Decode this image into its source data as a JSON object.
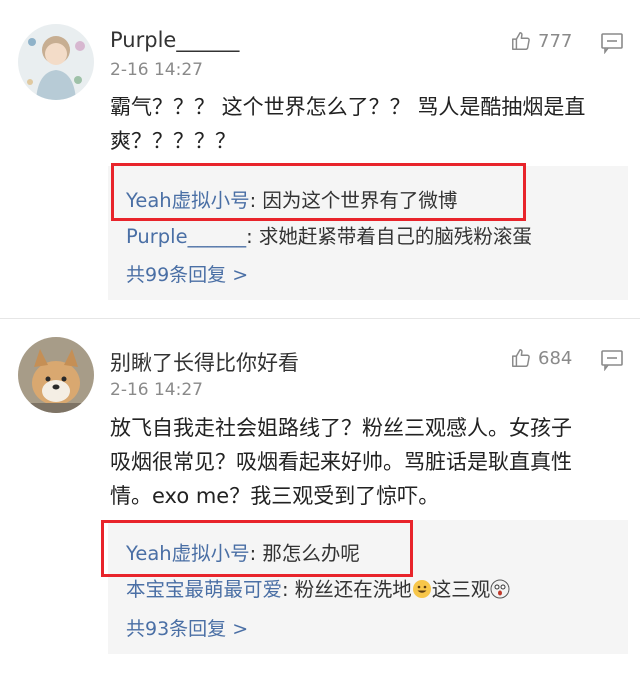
{
  "comments": [
    {
      "username": "Purple______",
      "time": "2-16 14:27",
      "likes": "777",
      "text_line1": "霸气？？？ 这个世界怎么了？？ 骂人是酷抽烟是直",
      "text_line2": "爽？？？？？",
      "replies": [
        {
          "name": "Yeah虚拟小号",
          "text": ": 因为这个世界有了微博"
        },
        {
          "name": "Purple______",
          "text": ": 求她赶紧带着自己的脑残粉滚蛋"
        }
      ],
      "more": "共99条回复 >"
    },
    {
      "username": "别瞅了长得比你好看",
      "time": "2-16 14:27",
      "likes": "684",
      "text_line1": "放飞自我走社会姐路线了？粉丝三观感人。女孩子",
      "text_line2": "吸烟很常见？吸烟看起来好帅。骂脏话是耿直真性",
      "text_line3": "情。exo me？我三观受到了惊吓。",
      "replies": [
        {
          "name": "Yeah虚拟小号",
          "text": ": 那怎么办呢"
        },
        {
          "name": "本宝宝最萌最可爱",
          "text_a": ": 粉丝还在洗地",
          "text_b": "这三观"
        }
      ],
      "more": "共93条回复 >"
    }
  ],
  "colors": {
    "link": "#4a6fa5",
    "highlight": "#e8242b",
    "reply_bg": "#f5f5f5",
    "meta": "#8a8a8a"
  },
  "icons": {
    "like": "thumbs-up-icon",
    "comment": "comment-bubble-icon"
  }
}
